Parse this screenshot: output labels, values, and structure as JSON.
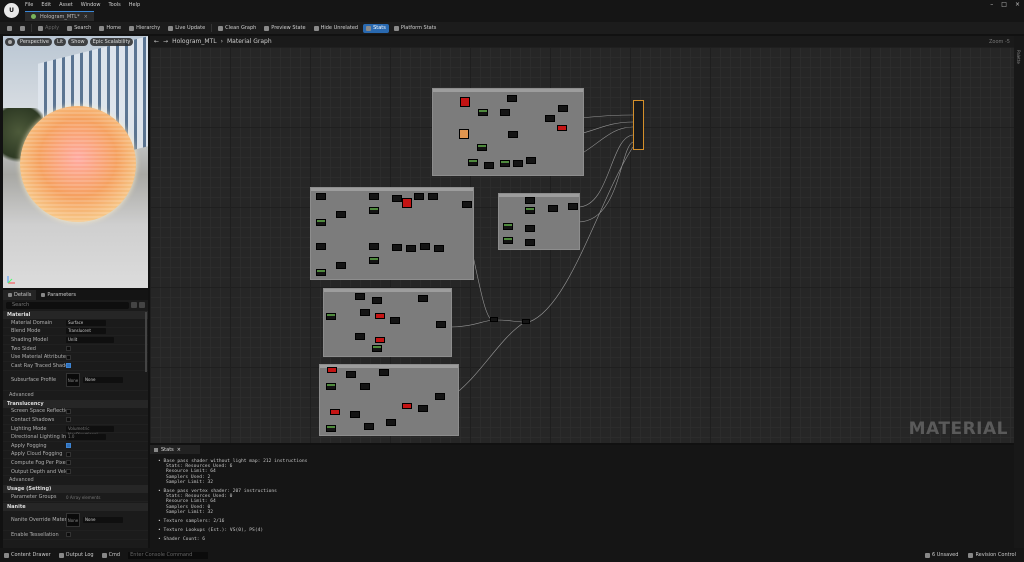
{
  "menu": [
    "File",
    "Edit",
    "Asset",
    "Window",
    "Tools",
    "Help"
  ],
  "document_tab": "Hologram_MTL*",
  "toolbar": {
    "apply": "Apply",
    "search": "Search",
    "home": "Home",
    "hierarchy": "Hierarchy",
    "live_update": "Live Update",
    "clean_graph": "Clean Graph",
    "preview_state": "Preview State",
    "hide_unrelated": "Hide Unrelated",
    "stats": "Stats",
    "platform_stats": "Platform Stats"
  },
  "viewport": {
    "perspective": "Perspective",
    "lit": "Lit",
    "show": "Show",
    "epic_label": "Epic Scalability"
  },
  "details": {
    "tabs": [
      "Details",
      "Parameters"
    ],
    "search_placeholder": "Search",
    "section_material": "Material",
    "material_domain_label": "Material Domain",
    "material_domain_value": "Surface",
    "blend_mode_label": "Blend Mode",
    "blend_mode_value": "Translucent",
    "shading_model_label": "Shading Model",
    "shading_model_value": "Unlit",
    "two_sided_label": "Two Sided",
    "material_attributes_label": "Use Material Attributes",
    "cast_ray_shadows_label": "Cast Ray Traced Shadows",
    "subsurface_label": "Subsurface Profile",
    "subsurface_value": "None",
    "thumb_label": "None",
    "advanced": "Advanced",
    "section_translucency": "Translucency",
    "screen_space_reflections_label": "Screen Space Reflections",
    "contact_shadows_label": "Contact Shadows",
    "lighting_mode_label": "Lighting Mode",
    "lighting_mode_value": "Volumetric NonDirectional",
    "directional_lighting_label": "Directional Lighting Intensity",
    "directional_lighting_value": "1.0",
    "apply_fogging_label": "Apply Fogging",
    "apply_cloud_fogging_label": "Apply Cloud Fogging",
    "compute_fog_label": "Compute Fog Per Pixel",
    "output_depth_label": "Output Depth and Velocity",
    "advanced2": "Advanced",
    "section_usage": "Usage (Setting)",
    "parameter_groups_label": "Parameter Groups",
    "parameter_groups_value": "0 Array elements",
    "section_nanite": "Nanite",
    "nanite_override_label": "Nanite Override Material",
    "nanite_override_value": "None",
    "build_translucency_label": "Enable Tessellation"
  },
  "graph": {
    "back": "←",
    "forward": "→",
    "title": "Hologram_MTL",
    "breadcrumb_sep": "›",
    "subtitle": "Material Graph",
    "zoom": "Zoom -5",
    "watermark": "MATERIAL",
    "side_label": "Palette"
  },
  "stats_panel": {
    "tab": "Stats",
    "blocks": [
      {
        "head": "Base pass shader without light map: 212 instructions",
        "lines": [
          "Stats: Resources Used: 6",
          "Resource Limit: 64",
          "Samplers Used: 2",
          "Sampler Limit: 32"
        ]
      },
      {
        "head": "Base pass vertex shader: 207 instructions",
        "lines": [
          "Stats: Resources Used: 0",
          "Resource Limit: 64",
          "Samplers Used: 0",
          "Sampler Limit: 32"
        ]
      },
      {
        "head": "Texture samplers: 2/16",
        "lines": []
      },
      {
        "head": "Texture Lookups (Est.): VS(0), PS(4)",
        "lines": []
      },
      {
        "head": "Shader Count: 6",
        "lines": []
      }
    ]
  },
  "statusbar": {
    "content_drawer": "Content Drawer",
    "output_log": "Output Log",
    "cmd": "Cmd",
    "console_placeholder": "Enter Console Command",
    "unsaved": "6 Unsaved",
    "revision": "Revision Control"
  },
  "colors": {
    "accent": "#2969b0",
    "node_header": "#4f8a3d",
    "comment_box": "#7c7c7c",
    "output_border": "#d48f2a"
  }
}
